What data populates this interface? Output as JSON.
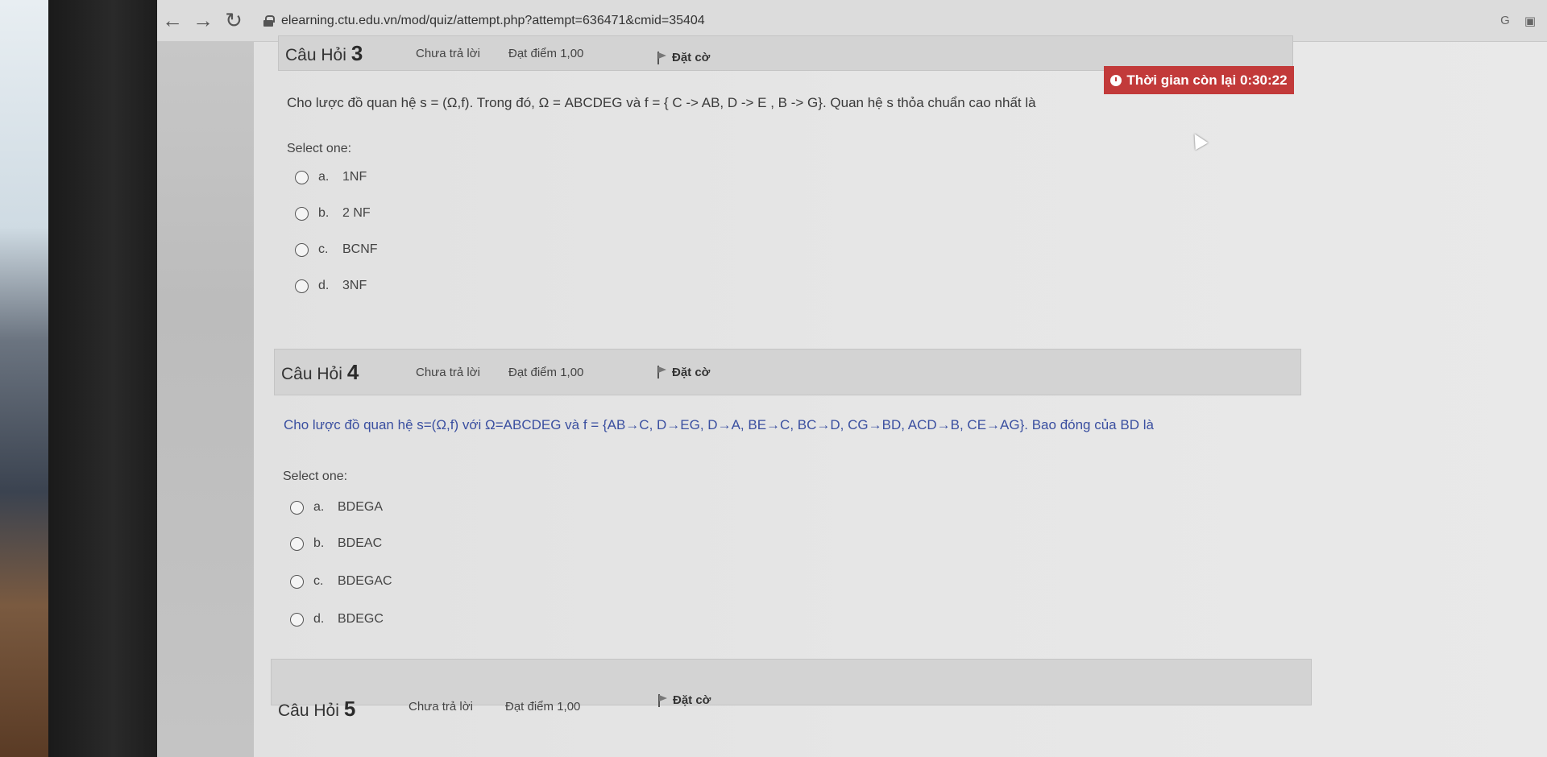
{
  "browser": {
    "url": "elearning.ctu.edu.vn/mod/quiz/attempt.php?attempt=636471&cmid=35404",
    "right_icons": [
      "G",
      "▣"
    ]
  },
  "timer": {
    "label": "Thời gian còn lại 0:30:22"
  },
  "questions": [
    {
      "title": "Câu Hỏi",
      "number": "3",
      "state": "Chưa trả lời",
      "mark": "Đạt điểm 1,00",
      "flag": "Đặt cờ",
      "text": "Cho lược đồ quan hệ s = (Ω,f). Trong đó, Ω = ABCDEG và f = { C -> AB, D -> E , B -> G}. Quan hệ s thỏa chuẩn cao nhất là",
      "select_label": "Select one:",
      "options": [
        {
          "letter": "a.",
          "text": "1NF"
        },
        {
          "letter": "b.",
          "text": "2 NF"
        },
        {
          "letter": "c.",
          "text": "BCNF"
        },
        {
          "letter": "d.",
          "text": "3NF"
        }
      ]
    },
    {
      "title": "Câu Hỏi",
      "number": "4",
      "state": "Chưa trả lời",
      "mark": "Đạt điểm 1,00",
      "flag": "Đặt cờ",
      "text": "Cho lược đồ quan hệ s=(Ω,f) với Ω=ABCDEG và f = {AB→C, D→EG, D→A, BE→C, BC→D, CG→BD, ACD→B, CE→AG}. Bao đóng của BD là",
      "select_label": "Select one:",
      "options": [
        {
          "letter": "a.",
          "text": "BDEGA"
        },
        {
          "letter": "b.",
          "text": "BDEAC"
        },
        {
          "letter": "c.",
          "text": "BDEGAC"
        },
        {
          "letter": "d.",
          "text": "BDEGC"
        }
      ]
    },
    {
      "title": "Câu Hỏi",
      "number": "5",
      "state": "Chưa trả lời",
      "mark": "Đạt điểm 1,00",
      "flag": "Đặt cờ"
    }
  ]
}
